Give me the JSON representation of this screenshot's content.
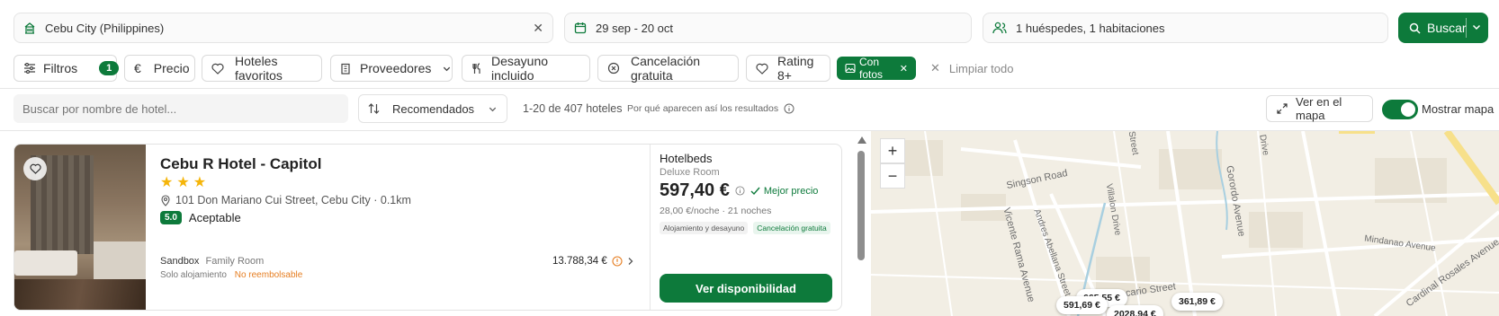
{
  "search": {
    "destination": "Cebu City (Philippines)",
    "dates": "29 sep - 20 oct",
    "guests": "1 huéspedes, 1 habitaciones",
    "search_button": "Buscar"
  },
  "filters": {
    "filters_label": "Filtros",
    "filters_count": "1",
    "price": "Precio",
    "favorites": "Hoteles favoritos",
    "providers": "Proveedores",
    "breakfast": "Desayuno incluido",
    "cancellation": "Cancelación gratuita",
    "rating": "Rating 8+",
    "photos": "Con fotos",
    "clear_all": "Limpiar todo"
  },
  "toolbar": {
    "hotel_search_placeholder": "Buscar por nombre de hotel...",
    "sort": "Recomendados",
    "results_count": "1-20 de 407 hoteles",
    "why_results": "Por qué aparecen así los resultados",
    "view_map": "Ver en el mapa",
    "show_map": "Mostrar mapa"
  },
  "hotel": {
    "name": "Cebu R Hotel - Capitol",
    "stars": 3,
    "address": "101 Don Mariano Cui Street, Cebu City · 0.1km",
    "score": "5.0",
    "score_label": "Aceptable",
    "alt_provider": "Sandbox",
    "alt_room": "Family Room",
    "alt_board": "Solo alojamiento",
    "alt_refund": "No reembolsable",
    "alt_price": "13.788,34 €",
    "provider": "Hotelbeds",
    "room": "Deluxe Room",
    "price": "597,40 €",
    "best_price": "Mejor precio",
    "per_night": "28,00 €/noche · 21 noches",
    "board_tag": "Alojamiento y desayuno",
    "cancel_tag": "Cancelación gratuita",
    "cta": "Ver disponibilidad"
  },
  "map": {
    "streets": [
      "Singson Road",
      "Vicente Rama Avenue",
      "Andres Abellana Street",
      "Villalon Drive",
      "Gorordo Avenue",
      "Mindanao Avenue",
      "Cardinal Rosales Avenue",
      "Escario Street",
      "Street",
      "Drive"
    ],
    "price_pins": [
      "591,69 €",
      "665,55 €",
      "361,89 €",
      "2028,94 €"
    ]
  },
  "colors": {
    "brand_green": "#0d7a3b",
    "star_yellow": "#f5b50a",
    "warning_orange": "#e67e22"
  }
}
